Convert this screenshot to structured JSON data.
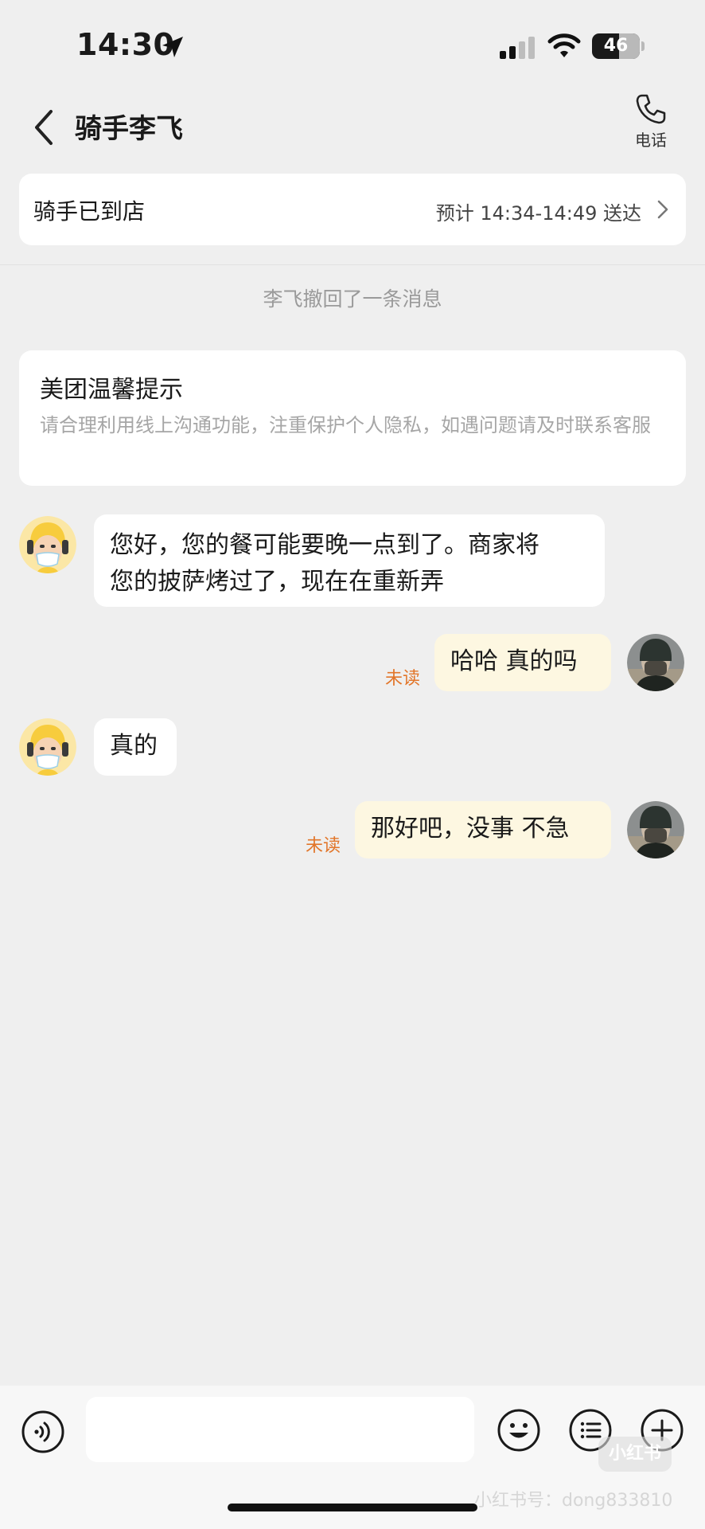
{
  "status_bar": {
    "time": "14:30",
    "battery": "46",
    "icons": [
      "location-arrow-icon",
      "cellular-signal-icon",
      "wifi-icon",
      "battery-icon"
    ]
  },
  "header": {
    "title": "骑手李飞",
    "phone_label": "电话",
    "icons": [
      "back-chevron-icon",
      "phone-icon"
    ]
  },
  "delivery": {
    "status": "骑手已到店",
    "eta": "预计 14:34-14:49 送达"
  },
  "system_message": "李飞撤回了一条消息",
  "tip": {
    "title": "美团温馨提示",
    "body": "请合理利用线上沟通功能，注重保护个人隐私，如遇问题请及时联系客服"
  },
  "messages": [
    {
      "from": "rider",
      "text_line1": "您好，您的餐可能要晚一点到了。商家将",
      "text_line2": "您的披萨烤过了，现在在重新弄"
    },
    {
      "from": "me",
      "text": "哈哈  真的吗",
      "read_status": "未读"
    },
    {
      "from": "rider",
      "text": "真的"
    },
    {
      "from": "me",
      "text": "那好吧，没事  不急",
      "read_status": "未读"
    }
  ],
  "input_bar": {
    "placeholder": "",
    "icons": [
      "voice-icon",
      "emoji-icon",
      "quick-reply-icon",
      "plus-icon"
    ]
  },
  "watermark": {
    "logo": "小红书",
    "text": "小红书号：dong833810"
  },
  "colors": {
    "background": "#efefef",
    "unread": "#e2762a",
    "my_bubble": "#fdf7e1",
    "rider_avatar": "#f7cc3d"
  }
}
